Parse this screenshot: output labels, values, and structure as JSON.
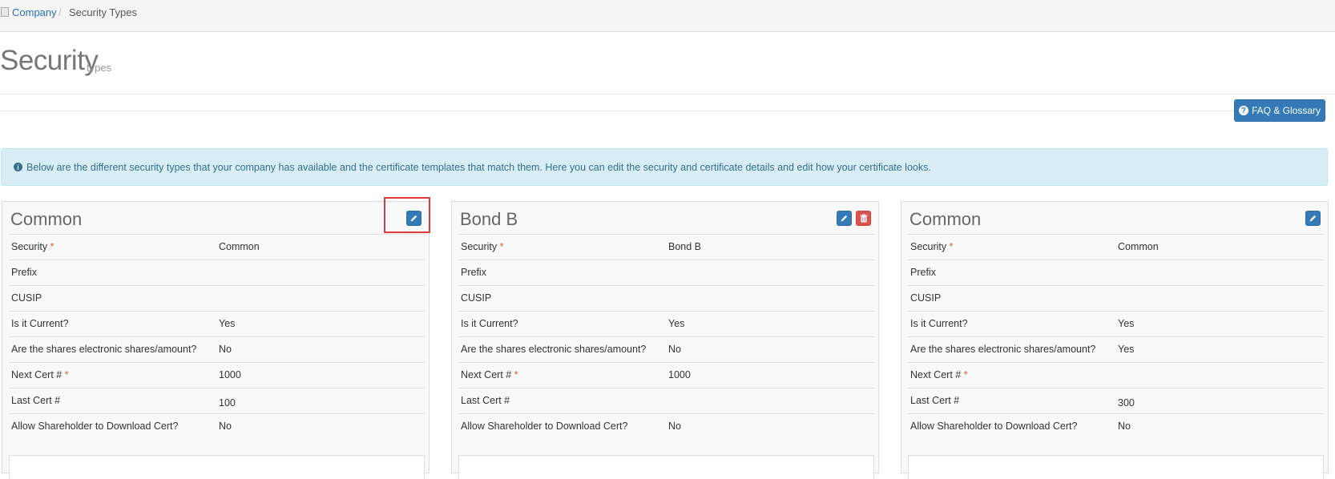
{
  "breadcrumb": {
    "link": "Company",
    "separator": "/",
    "current": "Security Types"
  },
  "header": {
    "title": "Security",
    "subtitle": "types"
  },
  "faq_button": {
    "label": "FAQ & Glossary",
    "icon": "question-circle-icon"
  },
  "info_banner": {
    "icon": "info-circle-icon",
    "text": "Below are the different security types that your company has available and the certificate templates that match them. Here you can edit the security and certificate details and edit how your certificate looks."
  },
  "colors": {
    "primary": "#337ab7",
    "danger": "#d9534f",
    "info_bg": "#d9edf7",
    "info_text": "#31708f",
    "highlight": "#e03b3b"
  },
  "cards": [
    {
      "title": "Common",
      "actions": [
        "edit"
      ],
      "rows": [
        {
          "label": "Security",
          "required": "*",
          "value": "Common"
        },
        {
          "label": "Prefix",
          "required": "",
          "value": ""
        },
        {
          "label": "CUSIP",
          "required": "",
          "value": ""
        },
        {
          "label": "Is it Current?",
          "required": "",
          "value": "Yes"
        },
        {
          "label": "Are the shares electronic shares/amount?",
          "required": "",
          "value": "No"
        },
        {
          "label": "Next Cert #",
          "required": "*",
          "value": "1000"
        },
        {
          "label": "Last Cert #",
          "required": "",
          "value": "100"
        },
        {
          "label": "Allow Shareholder to Download Cert?",
          "required": "",
          "value": "No"
        }
      ]
    },
    {
      "title": "Bond B",
      "actions": [
        "edit",
        "delete"
      ],
      "rows": [
        {
          "label": "Security",
          "required": "*",
          "value": "Bond B"
        },
        {
          "label": "Prefix",
          "required": "",
          "value": ""
        },
        {
          "label": "CUSIP",
          "required": "",
          "value": ""
        },
        {
          "label": "Is it Current?",
          "required": "",
          "value": "Yes"
        },
        {
          "label": "Are the shares electronic shares/amount?",
          "required": "",
          "value": "No"
        },
        {
          "label": "Next Cert #",
          "required": "*",
          "value": "1000"
        },
        {
          "label": "Last Cert #",
          "required": "",
          "value": ""
        },
        {
          "label": "Allow Shareholder to Download Cert?",
          "required": "",
          "value": "No"
        }
      ]
    },
    {
      "title": "Common",
      "actions": [
        "edit"
      ],
      "rows": [
        {
          "label": "Security",
          "required": "*",
          "value": "Common"
        },
        {
          "label": "Prefix",
          "required": "",
          "value": ""
        },
        {
          "label": "CUSIP",
          "required": "",
          "value": ""
        },
        {
          "label": "Is it Current?",
          "required": "",
          "value": "Yes"
        },
        {
          "label": "Are the shares electronic shares/amount?",
          "required": "",
          "value": "Yes"
        },
        {
          "label": "Next Cert #",
          "required": "*",
          "value": ""
        },
        {
          "label": "Last Cert #",
          "required": "",
          "value": "300"
        },
        {
          "label": "Allow Shareholder to Download Cert?",
          "required": "",
          "value": "No"
        }
      ]
    }
  ]
}
